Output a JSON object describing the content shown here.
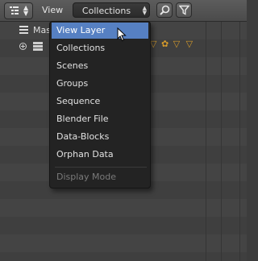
{
  "header": {
    "editor_type_icon": "outliner-icon",
    "view_menu_label": "View",
    "display_mode_selected": "Collections",
    "search_icon": "search-icon",
    "filter_icon": "filter-icon"
  },
  "outliner": {
    "rows": [
      {
        "label": "Mas",
        "icon": "scene-list-icon"
      },
      {
        "label": "",
        "icon": "expand-plus-icon"
      }
    ]
  },
  "menu": {
    "items": [
      {
        "label": "View Layer",
        "active": true
      },
      {
        "label": "Collections"
      },
      {
        "label": "Scenes"
      },
      {
        "label": "Groups"
      },
      {
        "label": "Sequence"
      },
      {
        "label": "Blender File"
      },
      {
        "label": "Data-Blocks"
      },
      {
        "label": "Orphan Data"
      }
    ],
    "title": "Display Mode"
  },
  "colors": {
    "accent": "#5680c2",
    "menu_bg": "#232323",
    "header_bg": "#4b4b4b",
    "orange_icons": "#d49a2b"
  }
}
